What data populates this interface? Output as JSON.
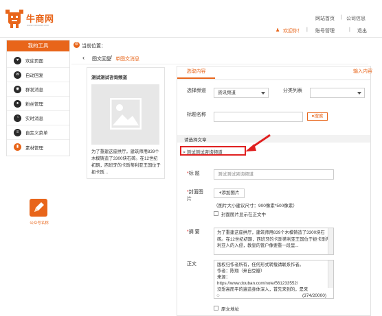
{
  "header": {
    "logo_text": "牛商网",
    "logo_sub": "www.nsrwww.com",
    "link_home": "网站首页",
    "link_company": "公司信息",
    "welcome": "欢迎你！",
    "account": "账号管理",
    "logout": "退出",
    "separator": "|"
  },
  "sidebar": {
    "title": "我的工具",
    "items": [
      {
        "label": "欢迎页面",
        "icon": "heart-icon"
      },
      {
        "label": "自动回复",
        "icon": "chat-icon"
      },
      {
        "label": "群发消息",
        "icon": "broadcast-icon"
      },
      {
        "label": "粉丝管理",
        "icon": "user-icon"
      },
      {
        "label": "实时消息",
        "icon": "clock-icon"
      },
      {
        "label": "自定义菜单",
        "icon": "menu-icon"
      },
      {
        "label": "素材管理",
        "icon": "material-icon",
        "active": true
      }
    ]
  },
  "app_tile": {
    "label": "公众号名称"
  },
  "breadcrumb": {
    "label": "当前位置：",
    "back": "‹",
    "path_root": "图文回复",
    "path_sep": " / ",
    "path_current": "单图文消息"
  },
  "card": {
    "title": "测试测试咨询频道",
    "text": "为了重建这座拱厅，建筑师用839个木模铸造了3300块石砖。在12世纪初期，西班牙的卡斯蒂利亚王国位于扼卡斯..."
  },
  "panel": {
    "tab": "选取内容",
    "import_link": "输入内容",
    "channel_label": "选择频道",
    "channel_value": "资讯频道",
    "category_label": "分类列表",
    "category_value": "",
    "title_search_label": "标题名称",
    "title_search_value": "",
    "search_button": "搜索",
    "section_label": "请选择文章",
    "picked_article": "> 测试测试咨询频道",
    "field_title_label": "标 题",
    "field_title_value": "测试测试咨询频道",
    "cover_label": "封面图片",
    "cover_button": "添加图片",
    "cover_hint": "（图片大小建议尺寸：900像素*500像素）",
    "cover_show_label": "封面图片显示在正文中",
    "abstract_label": "摘 要",
    "abstract_value": "为了重建这座拱厅，建筑师用839个木模铸造了3300块石砖。在12世纪初期，西班牙的卡斯蒂利亚王国位于扼卡斯蒂利亚人的入侵，教皇的管户像要重一段里...",
    "body_label": "正文",
    "body_lines": [
      "版权归作者所有，任何形式转载请联系作者。",
      "作者：陈翔（来自豆瓣）",
      "来源：",
      "https://www.douban.com/note/561233552/",
      "没想高而平的遍造身体深入，首先来到的，是来"
    ],
    "body_counter": "(374/20000)",
    "source_label": "原文地址",
    "required_mark": "*"
  },
  "colors": {
    "accent": "#e8651a",
    "highlight_red": "#e02020"
  }
}
